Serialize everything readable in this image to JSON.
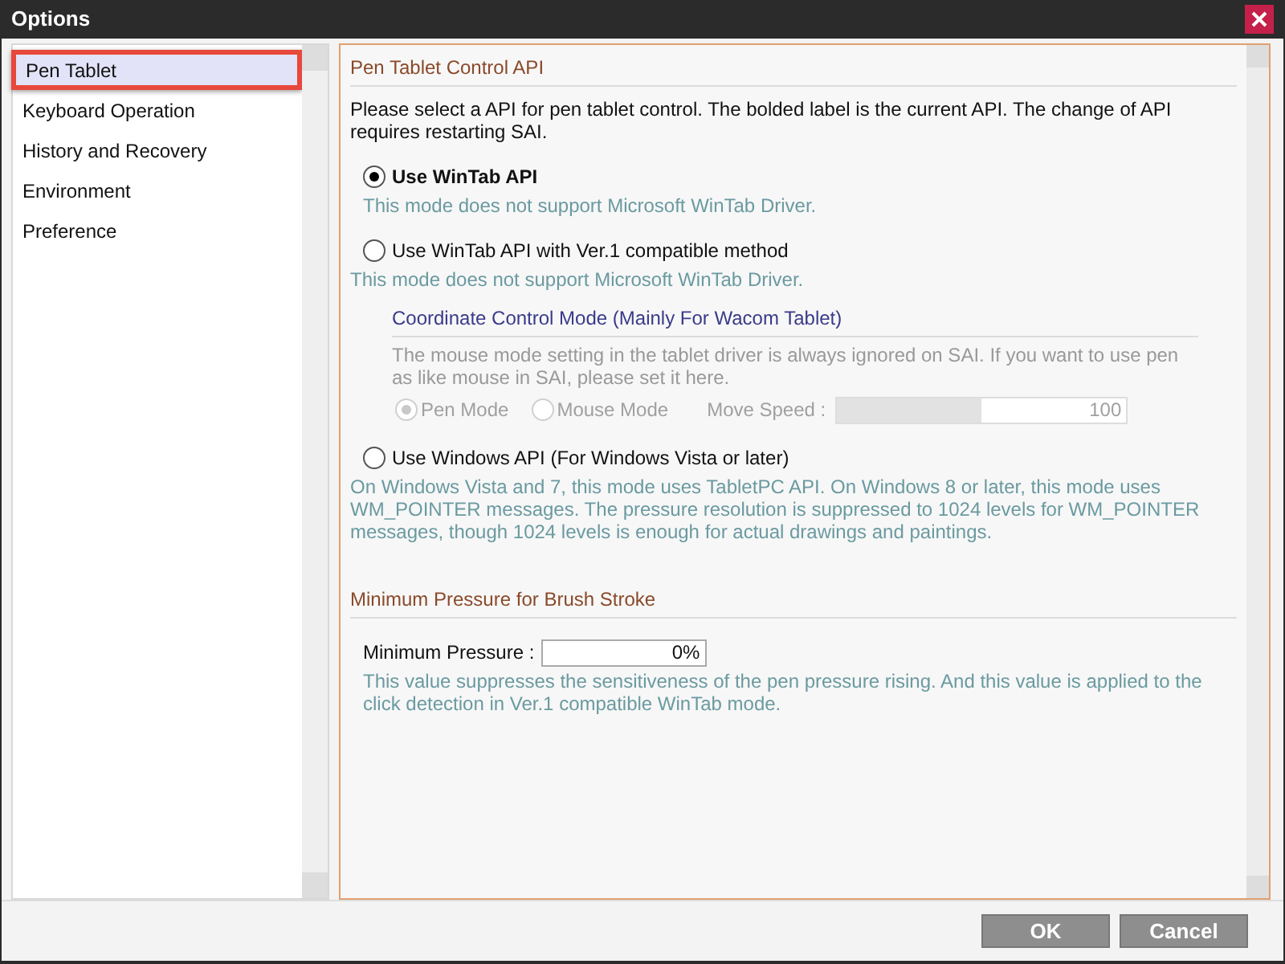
{
  "window": {
    "title": "Options"
  },
  "sidebar": {
    "items": [
      {
        "label": "Pen Tablet",
        "selected": true
      },
      {
        "label": "Keyboard Operation",
        "selected": false
      },
      {
        "label": "History and Recovery",
        "selected": false
      },
      {
        "label": "Environment",
        "selected": false
      },
      {
        "label": "Preference",
        "selected": false
      }
    ]
  },
  "section_api": {
    "heading": "Pen Tablet Control API",
    "description": "Please select a API for pen tablet control. The bolded label is the current API. The change of API requires restarting SAI.",
    "options": [
      {
        "label": "Use WinTab API",
        "selected": true,
        "note": "This mode does not support Microsoft WinTab Driver."
      },
      {
        "label": "Use WinTab API with Ver.1 compatible method",
        "selected": false,
        "note": "This mode does not support Microsoft WinTab Driver.",
        "sub": {
          "heading": "Coordinate Control Mode (Mainly For Wacom Tablet)",
          "disabled": true,
          "description": "The mouse mode setting in the tablet driver is always ignored on SAI. If you want to use pen as like mouse in SAI, please set it here.",
          "modes": [
            {
              "label": "Pen Mode",
              "selected": true
            },
            {
              "label": "Mouse Mode",
              "selected": false
            }
          ],
          "speed": {
            "label": "Move Speed :",
            "level": 0.5,
            "reading": "100"
          }
        }
      },
      {
        "label": "Use Windows API (For Windows Vista or later)",
        "selected": false,
        "note": "On Windows Vista and 7, this mode uses TabletPC API. On Windows 8 or later, this mode uses WM_POINTER messages. The pressure resolution is suppressed to 1024 levels for WM_POINTER messages, though 1024 levels is enough for actual drawings and paintings."
      }
    ]
  },
  "section_pressure": {
    "heading": "Minimum Pressure for Brush Stroke",
    "label": "Minimum Pressure :",
    "value": "0%",
    "note": "This value suppresses the sensitiveness of the pen pressure rising. And this value is applied to the click detection in Ver.1 compatible WinTab mode."
  },
  "buttons": [
    "OK",
    "Cancel"
  ]
}
